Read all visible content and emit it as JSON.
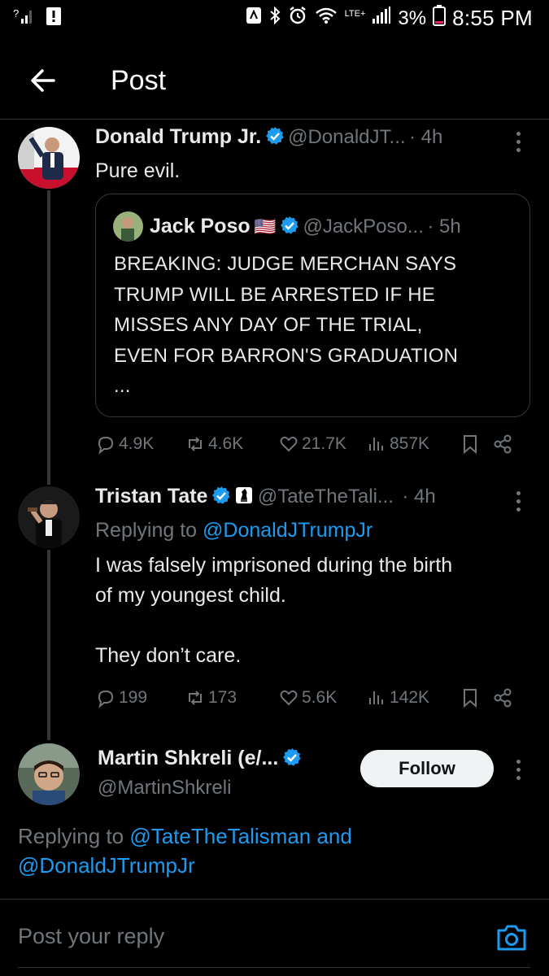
{
  "status_bar": {
    "left_icons": [
      "signal-question-icon",
      "alert-icon"
    ],
    "right_icons": [
      "nfc-icon",
      "bluetooth-icon",
      "alarm-icon",
      "wifi-icon",
      "signal-icon",
      "battery-icon"
    ],
    "lte": "LTE+",
    "battery": "3%",
    "time": "8:55 PM"
  },
  "header": {
    "title": "Post"
  },
  "tweets": [
    {
      "name": "Donald Trump Jr.",
      "handle": "@DonaldJT...",
      "time": "· 4h",
      "text": "Pure evil.",
      "quote": {
        "name": "Jack Poso",
        "flag": "🇺🇸",
        "handle": "@JackPoso...",
        "time": "· 5h",
        "lines": [
          "BREAKING: JUDGE MERCHAN SAYS",
          "TRUMP WILL BE ARRESTED IF HE",
          "MISSES ANY DAY OF THE TRIAL,",
          "EVEN FOR BARRON'S GRADUATION",
          "..."
        ]
      },
      "stats": {
        "replies": "4.9K",
        "reposts": "4.6K",
        "likes": "21.7K",
        "views": "857K"
      }
    },
    {
      "name": "Tristan Tate",
      "handle": "@TateTheTali...",
      "time": "· 4h",
      "replying_prefix": "Replying to",
      "replying_to": "@DonaldJTrumpJr",
      "lines": [
        "I was falsely imprisoned during the birth",
        "of my youngest child.",
        "",
        "They don’t care."
      ],
      "stats": {
        "replies": "199",
        "reposts": "173",
        "likes": "5.6K",
        "views": "142K"
      }
    },
    {
      "name": "Martin Shkreli (e/...",
      "handle": "@MartinShkreli",
      "follow_label": "Follow",
      "replying_prefix": "Replying to",
      "replying_to_1": "@TateTheTalisman and",
      "replying_to_2": "@DonaldJTrumpJr"
    }
  ],
  "reply_bar": {
    "placeholder": "Post your reply"
  },
  "colors": {
    "accent": "#1d9bf0",
    "background": "#000000",
    "text": "#e7e9ea",
    "muted": "#71767b"
  }
}
